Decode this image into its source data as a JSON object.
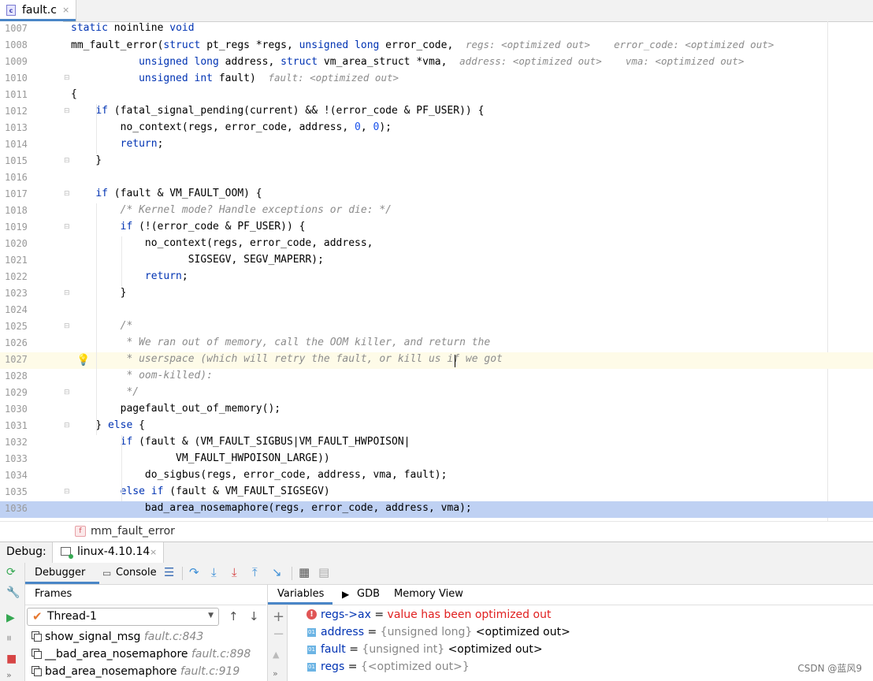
{
  "editor_tab": {
    "filename": "fault.c",
    "icon": "c-file-icon",
    "close": "×"
  },
  "code_lines": [
    {
      "num": "1007",
      "html": "<span class=\"kw\">static</span> noinline <span class=\"kw\">void</span>"
    },
    {
      "num": "1008",
      "html": "mm_fault_error(<span class=\"kw\">struct</span> pt_regs *regs, <span class=\"kw\">unsigned long</span> error_code,  <span class=\"hint\">regs: &lt;optimized out&gt;    error_code: &lt;optimized out&gt;</span>"
    },
    {
      "num": "1009",
      "html": "           <span class=\"kw\">unsigned long</span> address, <span class=\"kw\">struct</span> vm_area_struct *vma,  <span class=\"hint\">address: &lt;optimized out&gt;    vma: &lt;optimized out&gt;</span>"
    },
    {
      "num": "1010",
      "html": "           <span class=\"kw\">unsigned int</span> fault)  <span class=\"hint\">fault: &lt;optimized out&gt;</span>"
    },
    {
      "num": "1011",
      "html": "{"
    },
    {
      "num": "1012",
      "html": "    <span class=\"kw\">if</span> (fatal_signal_pending(current) &amp;&amp; !(error_code &amp; PF_USER)) {"
    },
    {
      "num": "1013",
      "html": "        no_context(regs, error_code, address, <span class=\"num\">0</span>, <span class=\"num\">0</span>);"
    },
    {
      "num": "1014",
      "html": "        <span class=\"kw\">return</span>;"
    },
    {
      "num": "1015",
      "html": "    }"
    },
    {
      "num": "1016",
      "html": ""
    },
    {
      "num": "1017",
      "html": "    <span class=\"kw\">if</span> (fault &amp; VM_FAULT_OOM) {"
    },
    {
      "num": "1018",
      "html": "        <span class=\"cm\">/* Kernel mode? Handle exceptions or die: */</span>"
    },
    {
      "num": "1019",
      "html": "        <span class=\"kw\">if</span> (!(error_code &amp; PF_USER)) {"
    },
    {
      "num": "1020",
      "html": "            no_context(regs, error_code, address,"
    },
    {
      "num": "1021",
      "html": "                   SIGSEGV, SEGV_MAPERR);"
    },
    {
      "num": "1022",
      "html": "            <span class=\"kw\">return</span>;"
    },
    {
      "num": "1023",
      "html": "        }"
    },
    {
      "num": "1024",
      "html": ""
    },
    {
      "num": "1025",
      "html": "        <span class=\"cm\">/*</span>"
    },
    {
      "num": "1026",
      "html": "<span class=\"cm\">         * We ran out of memory, call the OOM killer, and return the</span>"
    },
    {
      "num": "1027",
      "html": "<span class=\"cm\">         * userspace (which will retry the fault, or kill us if we got</span>"
    },
    {
      "num": "1028",
      "html": "<span class=\"cm\">         * oom-killed):</span>"
    },
    {
      "num": "1029",
      "html": "<span class=\"cm\">         */</span>"
    },
    {
      "num": "1030",
      "html": "        pagefault_out_of_memory();"
    },
    {
      "num": "1031",
      "html": "    } <span class=\"kw\">else</span> {"
    },
    {
      "num": "1032",
      "html": "        <span class=\"kw\">if</span> (fault &amp; (VM_FAULT_SIGBUS|VM_FAULT_HWPOISON|"
    },
    {
      "num": "1033",
      "html": "                 VM_FAULT_HWPOISON_LARGE))"
    },
    {
      "num": "1034",
      "html": "            do_sigbus(regs, error_code, address, vma, fault);"
    },
    {
      "num": "1035",
      "html": "        <span class=\"kw\">else if</span> (fault &amp; VM_FAULT_SIGSEGV)"
    },
    {
      "num": "1036",
      "html": "            bad_area_nosemaphore(regs, error_code, address, vma);"
    }
  ],
  "breadcrumb": {
    "badge": "f",
    "label": "mm_fault_error"
  },
  "debug": {
    "title": "Debug:",
    "session": {
      "label": "linux-4.10.14",
      "close": "×"
    },
    "tabs": {
      "debugger": "Debugger",
      "console": "Console"
    },
    "frames_header": "Frames",
    "thread": "Thread-1",
    "frames": [
      {
        "name": "show_signal_msg",
        "loc": "fault.c:843"
      },
      {
        "name": "__bad_area_nosemaphore",
        "loc": "fault.c:898"
      },
      {
        "name": "bad_area_nosemaphore",
        "loc": "fault.c:919"
      }
    ],
    "var_tabs": {
      "variables": "Variables",
      "gdb": "GDB",
      "memory": "Memory View"
    },
    "variables": [
      {
        "kind": "error",
        "name": "regs->ax",
        "eq": " = ",
        "type": "",
        "value": "value has been optimized out"
      },
      {
        "kind": "var",
        "name": "address",
        "eq": " = ",
        "type": "{unsigned long}",
        "value": " <optimized out>"
      },
      {
        "kind": "var",
        "name": "fault",
        "eq": " = ",
        "type": "{unsigned int}",
        "value": " <optimized out>"
      },
      {
        "kind": "var",
        "name": "regs",
        "eq": " = ",
        "type": "{<optimized out>}",
        "value": ""
      }
    ]
  },
  "watermark": "CSDN @蓝风9",
  "colors": {
    "accent": "#4a86c7",
    "exec_line": "#bfd1f3",
    "caret_line": "#fefbe8",
    "keyword": "#0033b3",
    "error": "#e02020"
  }
}
